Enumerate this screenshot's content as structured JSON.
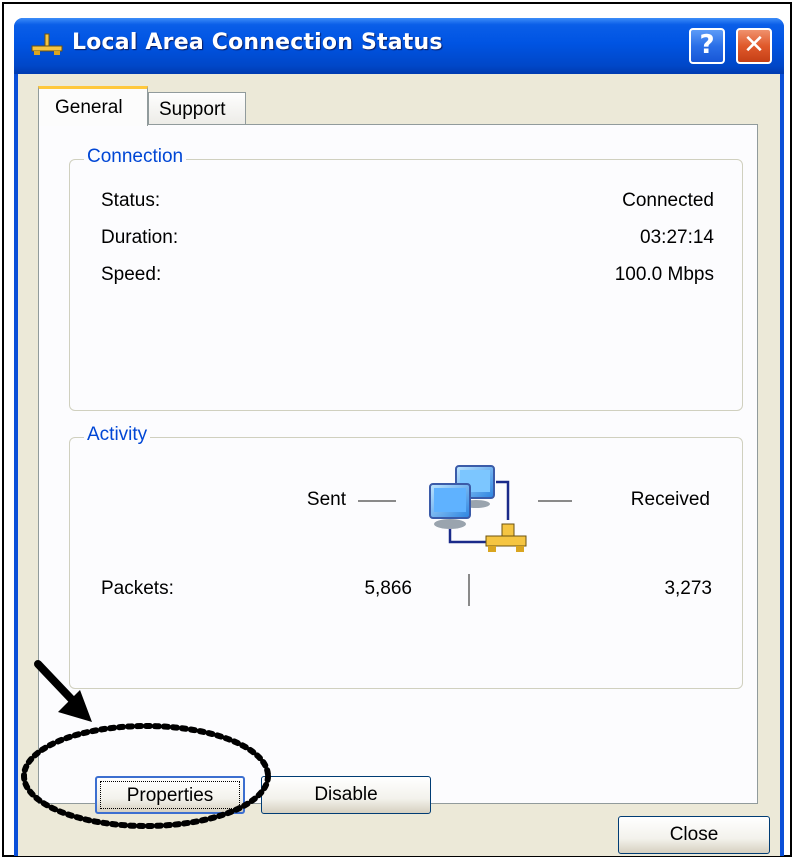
{
  "window": {
    "title": "Local Area Connection Status",
    "help_button": "?",
    "close_button": "✕"
  },
  "tabs": [
    {
      "label": "General",
      "selected": true
    },
    {
      "label": "Support",
      "selected": false
    }
  ],
  "connection": {
    "group_title": "Connection",
    "status_label": "Status:",
    "status_value": "Connected",
    "duration_label": "Duration:",
    "duration_value": "03:27:14",
    "speed_label": "Speed:",
    "speed_value": "100.0 Mbps"
  },
  "activity": {
    "group_title": "Activity",
    "sent_label": "Sent",
    "received_label": "Received",
    "packets_label": "Packets:",
    "packets_sent": "5,866",
    "packets_received": "3,273"
  },
  "buttons": {
    "properties": "Properties",
    "disable": "Disable",
    "close": "Close"
  },
  "icons": {
    "title": "network-connection-icon",
    "activity": "network-computers-icon"
  },
  "colors": {
    "titlebar": "#0054e3",
    "group_title": "#0046d5",
    "close_button": "#e0592b",
    "tab_highlight": "#ffc83c"
  }
}
